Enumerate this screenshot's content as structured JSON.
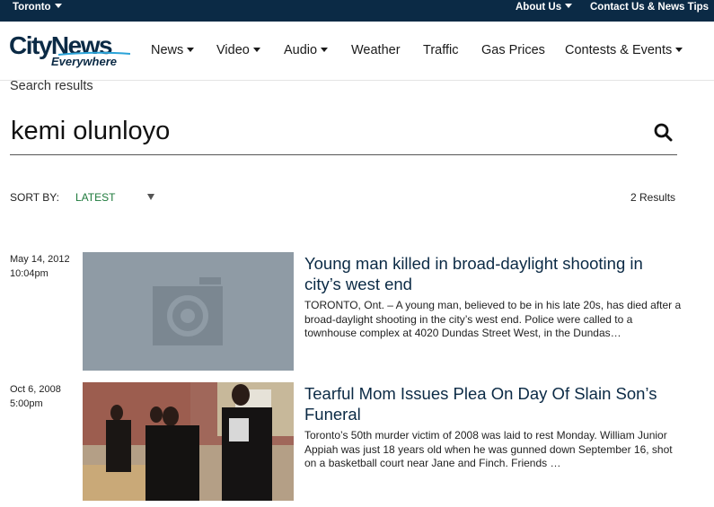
{
  "topbar": {
    "city": "Toronto",
    "about": "About Us",
    "contact": "Contact Us & News Tips"
  },
  "logo": {
    "line1": "CityNews",
    "line2": "Everywhere"
  },
  "nav": {
    "items": [
      {
        "label": "News",
        "dropdown": true
      },
      {
        "label": "Video",
        "dropdown": true
      },
      {
        "label": "Audio",
        "dropdown": true
      },
      {
        "label": "Weather",
        "dropdown": false
      },
      {
        "label": "Traffic",
        "dropdown": false
      },
      {
        "label": "Gas Prices",
        "dropdown": false
      },
      {
        "label": "Contests & Events",
        "dropdown": true
      }
    ]
  },
  "search": {
    "heading": "Search results",
    "query": "kemi olunloyo",
    "icon": "search-icon"
  },
  "sort": {
    "label": "SORT BY:",
    "selected": "LATEST",
    "results": "2 Results"
  },
  "articles": [
    {
      "date": "May 14, 2012",
      "time": "10:04pm",
      "thumb": "placeholder-camera-icon",
      "title": "Young man killed in broad-daylight shooting in city’s west end",
      "summary": "TORONTO, Ont. – A young man, believed to be in his late 20s, has died after a broad-daylight shooting in the city’s west end. Police were called to a townhouse complex at 4020 Dundas Street West, in the Dundas…"
    },
    {
      "date": "Oct 6, 2008",
      "time": "5:00pm",
      "thumb": "funeral-photo",
      "title": "Tearful Mom Issues Plea On Day Of Slain Son’s Funeral",
      "summary": "Toronto’s 50th murder victim of 2008 was laid to rest Monday. William Junior Appiah was just 18 years old when he was gunned down September 16, shot on a basketball court near Jane and Finch. Friends …"
    }
  ],
  "colors": {
    "topbar": "#0b2a45",
    "accent": "#1e7a3c",
    "title": "#0b2a45"
  }
}
